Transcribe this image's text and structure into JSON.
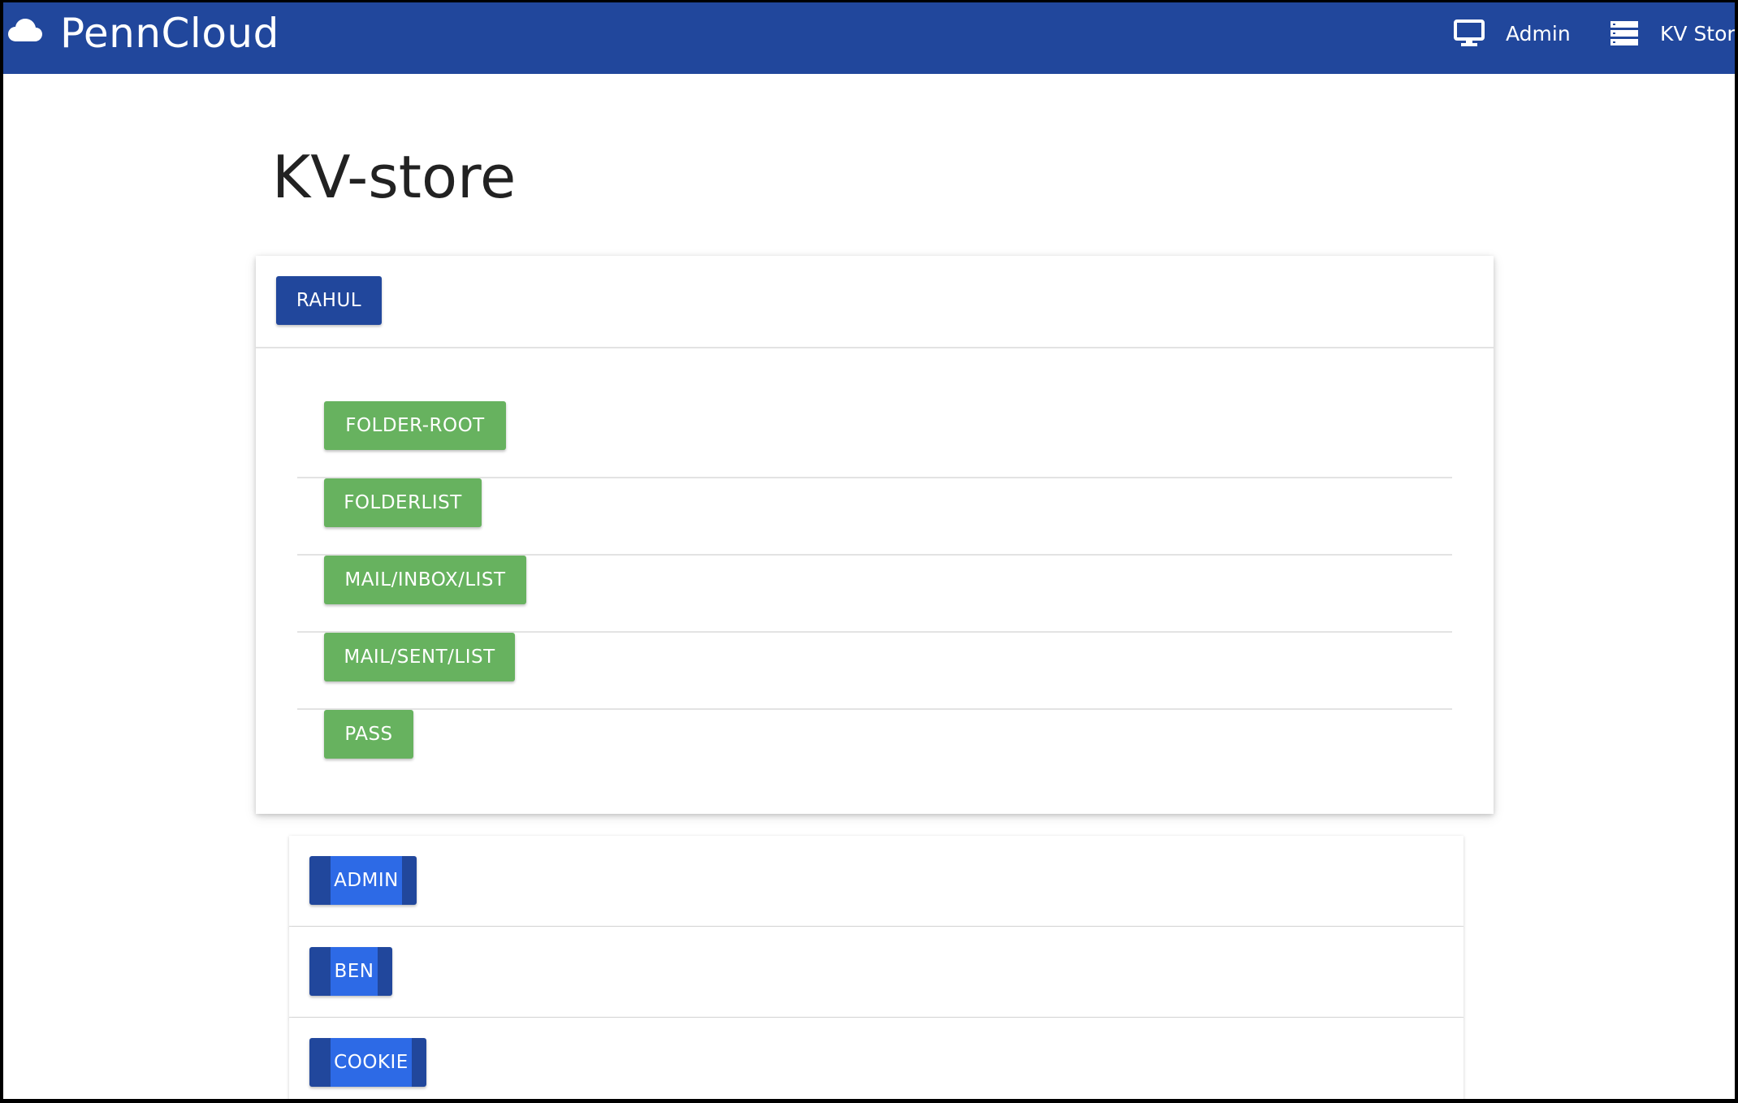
{
  "navbar": {
    "brand": "PennCloud",
    "links": [
      {
        "label": "Admin",
        "icon": "monitor-icon"
      },
      {
        "label": "KV Store",
        "icon": "server-icon"
      }
    ]
  },
  "page": {
    "title": "KV-store"
  },
  "expanded_user": {
    "label": "RAHUL",
    "keys": [
      "FOLDER-ROOT",
      "FOLDERLIST",
      "MAIL/INBOX/LIST",
      "MAIL/SENT/LIST",
      "PASS"
    ]
  },
  "users": [
    "ADMIN",
    "BEN",
    "COOKIE"
  ],
  "colors": {
    "navbar": "#21479c",
    "user_button": "#21479c",
    "key_button": "#67b25f",
    "user_button_hover": "#2d6ae6"
  }
}
